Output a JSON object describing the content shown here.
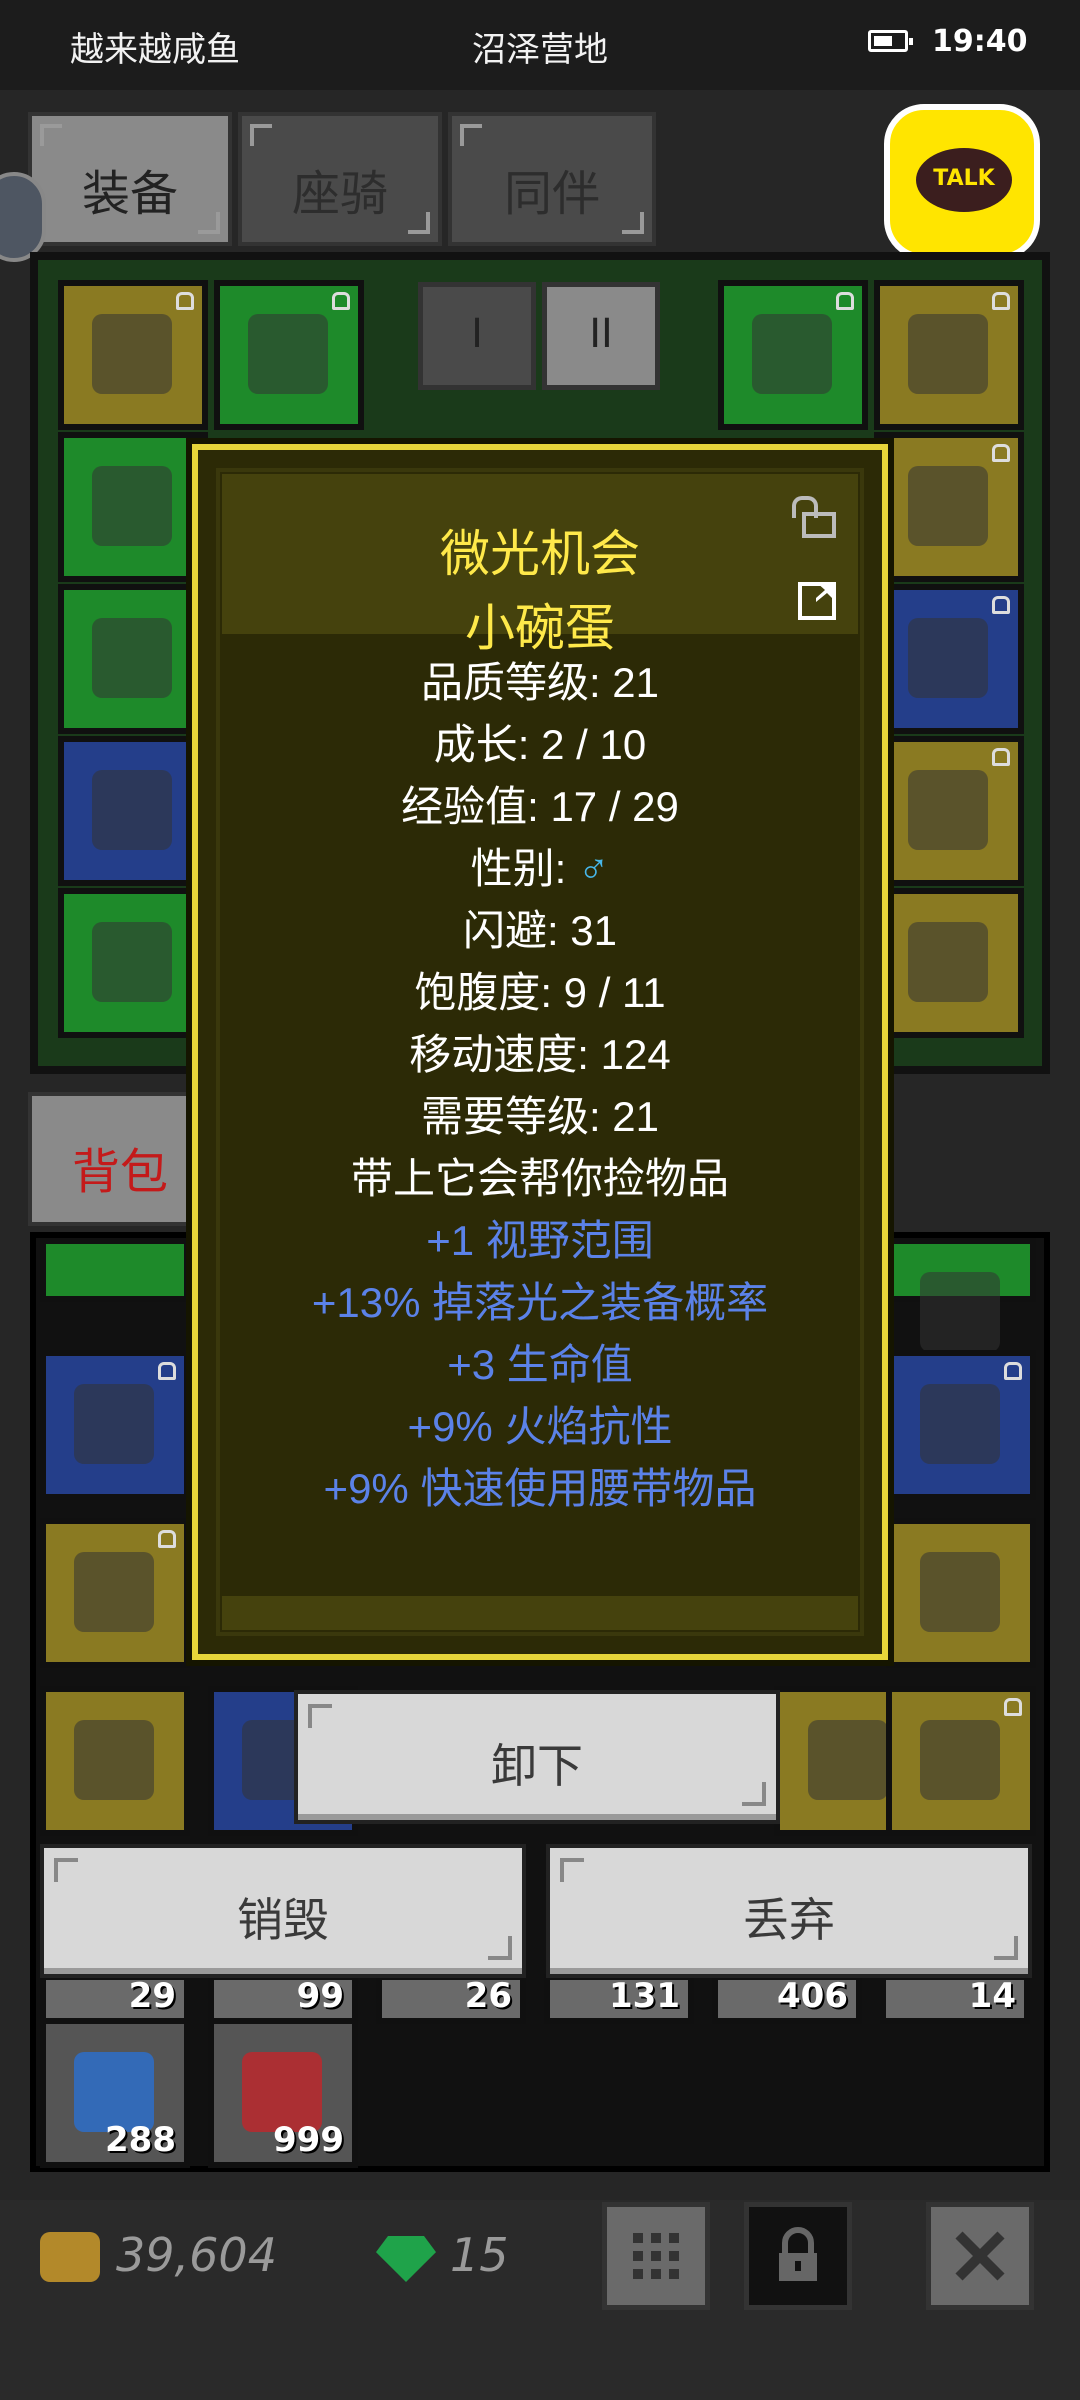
{
  "status_bar": {
    "left_text": "越来越咸鱼",
    "center_text": "沼泽营地",
    "time": "19:40"
  },
  "tabs": [
    {
      "label": "装备",
      "active": true
    },
    {
      "label": "座骑",
      "active": false
    },
    {
      "label": "同伴",
      "active": false
    }
  ],
  "talk_button": {
    "label": "TALK"
  },
  "equipment": {
    "page_buttons": [
      "I",
      "II"
    ],
    "slot_colors": {
      "gold": "#8a7a22",
      "green": "#1e8a2a",
      "blue": "#243e8a"
    }
  },
  "bag": {
    "tab_label": "背包 (",
    "item_counts": [
      "29",
      "99",
      "26",
      "131",
      "406",
      "14",
      "288",
      "999"
    ]
  },
  "tooltip": {
    "title": "微光机会",
    "name": "小碗蛋",
    "stats": [
      "品质等级: 21",
      "成长: 2 / 10",
      "经验值: 17 / 29"
    ],
    "gender_label": "性别: ",
    "gender_symbol": "♂",
    "stats2": [
      "闪避: 31",
      "饱腹度: 9 / 11",
      "移动速度: 124",
      "需要等级: 21",
      "带上它会帮你捡物品"
    ],
    "bonuses": [
      "+1 视野范围",
      "+13% 掉落光之装备概率",
      "+3 生命值",
      "+9% 火焰抗性",
      "+9% 快速使用腰带物品"
    ],
    "colors": {
      "title": "#ffe94a",
      "bonus": "#5b82e8",
      "male": "#47b7ea"
    }
  },
  "actions": {
    "unequip": "卸下",
    "destroy": "销毁",
    "drop": "丢弃"
  },
  "currency": {
    "gold": "39,604",
    "gems": "15"
  },
  "bottom_icons": [
    "grid-icon",
    "lock-icon",
    "close-icon"
  ]
}
